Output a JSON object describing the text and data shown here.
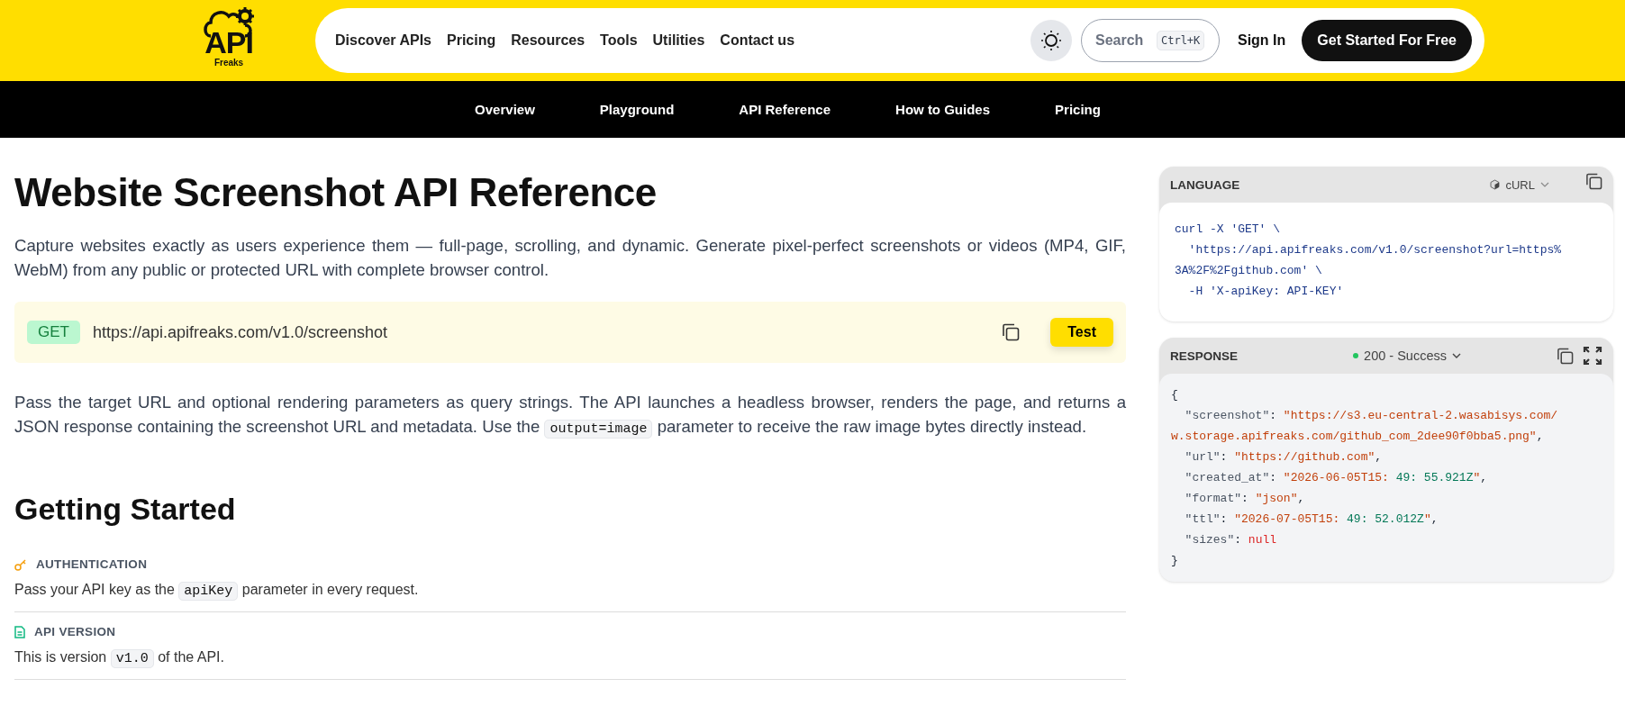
{
  "logo": {
    "word": "API",
    "sub": "Freaks"
  },
  "nav": [
    {
      "label": "Discover APIs"
    },
    {
      "label": "Pricing"
    },
    {
      "label": "Resources"
    },
    {
      "label": "Tools"
    },
    {
      "label": "Utilities"
    },
    {
      "label": "Contact us"
    }
  ],
  "search": {
    "placeholder": "Search",
    "shortcut": "Ctrl+K"
  },
  "sign_in": "Sign In",
  "cta": "Get Started For Free",
  "subnav": [
    {
      "label": "Overview"
    },
    {
      "label": "Playground"
    },
    {
      "label": "API Reference"
    },
    {
      "label": "How to Guides"
    },
    {
      "label": "Pricing"
    }
  ],
  "title": "Website Screenshot API Reference",
  "intro": "Capture websites exactly as users experience them — full-page, scrolling, and dynamic. Generate pixel-perfect screenshots or videos (MP4, GIF, WebM) from any public or protected URL with complete browser control.",
  "endpoint": {
    "method": "GET",
    "url": "https://api.apifreaks.com/v1.0/screenshot",
    "button": "Test"
  },
  "description": [
    {
      "kind": "text",
      "text": "Pass the target URL and optional rendering parameters as query strings. The API launches a headless browser, renders the page, and returns a JSON response containing the screenshot URL and metadata. Use the "
    },
    {
      "kind": "code",
      "text": "output=image"
    },
    {
      "kind": "text",
      "text": " parameter to receive the raw image bytes directly instead."
    }
  ],
  "getting_started": {
    "heading": "Getting Started",
    "sections": [
      {
        "kind": "key",
        "label": "AUTHENTICATION",
        "body": [
          {
            "kind": "text",
            "text": "Pass your API key as the "
          },
          {
            "kind": "code",
            "text": "apiKey"
          },
          {
            "kind": "text",
            "text": " parameter in every request."
          }
        ]
      },
      {
        "kind": "doc",
        "label": "API VERSION",
        "body": [
          {
            "kind": "text",
            "text": "This is version "
          },
          {
            "kind": "code",
            "text": "v1.0"
          },
          {
            "kind": "text",
            "text": " of the API."
          }
        ]
      }
    ]
  },
  "language_panel": {
    "title": "LANGUAGE",
    "language": "cURL",
    "code": [
      "curl -X 'GET' \\",
      "  'https://api.apifreaks.com/v1.0/screenshot?url=https%",
      "3A%2F%2Fgithub.com' \\",
      "  -H 'X-apiKey: API-KEY'"
    ]
  },
  "response_panel": {
    "title": "RESPONSE",
    "status": "200 - Success",
    "lines": [
      [
        {
          "kind": "punct",
          "text": "{"
        }
      ],
      [
        {
          "kind": "key",
          "text": "  \"screenshot\""
        },
        {
          "kind": "punct",
          "text": ": "
        },
        {
          "kind": "string",
          "text": "\"https://s3.eu-central-2.wasabisys.com/"
        }
      ],
      [
        {
          "kind": "string",
          "text": "w.storage.apifreaks.com/github_com_2dee90f0bba5.png\""
        },
        {
          "kind": "punct",
          "text": ","
        }
      ],
      [
        {
          "kind": "key",
          "text": "  \"url\""
        },
        {
          "kind": "punct",
          "text": ": "
        },
        {
          "kind": "string",
          "text": "\"https://github.com\""
        },
        {
          "kind": "punct",
          "text": ","
        }
      ],
      [
        {
          "kind": "key",
          "text": "  \"created_at\""
        },
        {
          "kind": "punct",
          "text": ": "
        },
        {
          "kind": "string",
          "text": "\"2026-06-05T15:"
        },
        {
          "kind": "number",
          "text": " 49: 55.921Z"
        },
        {
          "kind": "string",
          "text": "\""
        },
        {
          "kind": "punct",
          "text": ","
        }
      ],
      [
        {
          "kind": "key",
          "text": "  \"format\""
        },
        {
          "kind": "punct",
          "text": ": "
        },
        {
          "kind": "string",
          "text": "\"json\""
        },
        {
          "kind": "punct",
          "text": ","
        }
      ],
      [
        {
          "kind": "key",
          "text": "  \"ttl\""
        },
        {
          "kind": "punct",
          "text": ": "
        },
        {
          "kind": "string",
          "text": "\"2026-07-05T15:"
        },
        {
          "kind": "number",
          "text": " 49: 52.012Z"
        },
        {
          "kind": "string",
          "text": "\""
        },
        {
          "kind": "punct",
          "text": ","
        }
      ],
      [
        {
          "kind": "key",
          "text": "  \"sizes\""
        },
        {
          "kind": "punct",
          "text": ": "
        },
        {
          "kind": "null",
          "text": "null"
        }
      ],
      [
        {
          "kind": "punct",
          "text": "}"
        }
      ]
    ]
  }
}
